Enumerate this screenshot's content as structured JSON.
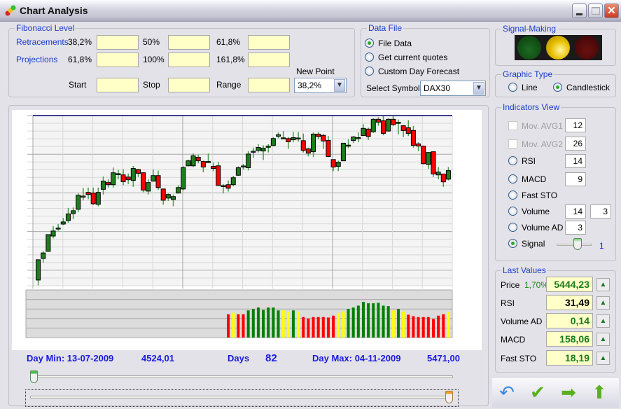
{
  "window": {
    "title": "Chart Analysis",
    "minimize": "_",
    "maximize": "□",
    "close": "✕"
  },
  "fibonacci": {
    "title": "Fibonacci Level",
    "retracements_label": "Retracements",
    "projections_label": "Projections",
    "retracements": [
      {
        "label": "38,2%",
        "value": ""
      },
      {
        "label": "50%",
        "value": ""
      },
      {
        "label": "61,8%",
        "value": ""
      }
    ],
    "projections": [
      {
        "label": "61,8%",
        "value": ""
      },
      {
        "label": "100%",
        "value": ""
      },
      {
        "label": "161,8%",
        "value": ""
      }
    ],
    "start_label": "Start",
    "stop_label": "Stop",
    "range_label": "Range",
    "start": "",
    "stop": "",
    "range": "",
    "new_point_label": "New Point",
    "new_point": "38,2%"
  },
  "data_file": {
    "title": "Data File",
    "options": [
      "File Data",
      "Get current quotes",
      "Custom Day Forecast"
    ],
    "selected": 0,
    "symbol_label": "Select Symbol",
    "symbol": "DAX30"
  },
  "signal_making": {
    "title": "Signal-Making",
    "lights": {
      "green": "#0c4a10",
      "yellow": "#f0cc10",
      "red": "#4a0808"
    },
    "active": "yellow"
  },
  "graphic_type": {
    "title": "Graphic Type",
    "options": [
      "Line",
      "Candlestick"
    ],
    "selected": 1
  },
  "indicators": {
    "title": "Indicators View",
    "mov_avg1": {
      "label": "Mov. AVG1",
      "value": "12",
      "enabled": false
    },
    "mov_avg2": {
      "label": "Mov. AVG2",
      "value": "26",
      "enabled": false
    },
    "rsi": {
      "label": "RSI",
      "value": "14"
    },
    "macd": {
      "label": "MACD",
      "value": "9"
    },
    "fast_sto": {
      "label": "Fast STO"
    },
    "volume": {
      "label": "Volume",
      "value1": "14",
      "value2": "3"
    },
    "volume_ad": {
      "label": "Volume AD",
      "value": "3"
    },
    "signal": {
      "label": "Signal",
      "slider_value": "1"
    },
    "selected": "Signal"
  },
  "last_values": {
    "title": "Last Values",
    "price_label": "Price",
    "price_change": "1,70%",
    "price": "5444,23",
    "rsi_label": "RSI",
    "rsi": "31,49",
    "volume_ad_label": "Volume AD",
    "volume_ad": "0,14",
    "macd_label": "MACD",
    "macd": "158,06",
    "fast_sto_label": "Fast STO",
    "fast_sto": "18,19",
    "trend_icon": "▲"
  },
  "stats": {
    "day_min": "Day Min: 13-07-2009",
    "min_value": "4524,01",
    "days_label": "Days",
    "days": "82",
    "day_max": "Day Max: 04-11-2009",
    "max_value": "5471,00"
  },
  "toolbar": {
    "undo_icon": "↶",
    "ok_icon": "✔",
    "next_icon": "➡",
    "up_icon": "⬆"
  },
  "chart_data": {
    "type": "candlestick",
    "ylim": [
      4524.01,
      5471.0
    ],
    "grid": true,
    "colors": {
      "up": "#1e7e1e",
      "down": "#ff0000"
    },
    "candles": [
      [
        4552,
        4666,
        4523,
        4666
      ],
      [
        4673,
        4716,
        4650,
        4704
      ],
      [
        4713,
        4807,
        4713,
        4807
      ],
      [
        4799,
        4854,
        4786,
        4827
      ],
      [
        4844,
        4867,
        4828,
        4844
      ],
      [
        4866,
        4900,
        4861,
        4878
      ],
      [
        4886,
        4957,
        4874,
        4923
      ],
      [
        4925,
        4959,
        4894,
        4941
      ],
      [
        4949,
        5038,
        4933,
        5028
      ],
      [
        5023,
        5069,
        4999,
        5023
      ],
      [
        5044,
        5071,
        5005,
        5032
      ],
      [
        5040,
        5071,
        4973,
        4980
      ],
      [
        4977,
        5071,
        4966,
        5044
      ],
      [
        5061,
        5133,
        5032,
        5107
      ],
      [
        5099,
        5117,
        5071,
        5087
      ],
      [
        5087,
        5183,
        5071,
        5154
      ],
      [
        5149,
        5170,
        5117,
        5149
      ],
      [
        5142,
        5174,
        5084,
        5104
      ],
      [
        5130,
        5150,
        5091,
        5115
      ],
      [
        5111,
        5192,
        5075,
        5178
      ],
      [
        5172,
        5176,
        5130,
        5151
      ],
      [
        5154,
        5157,
        5045,
        5057
      ],
      [
        5051,
        5117,
        5032,
        5099
      ],
      [
        5107,
        5172,
        5104,
        5138
      ],
      [
        5138,
        5166,
        5058,
        5071
      ],
      [
        5063,
        5063,
        4975,
        5000
      ],
      [
        5012,
        5038,
        4996,
        5032
      ],
      [
        5004,
        5032,
        4966,
        5020
      ],
      [
        5040,
        5084,
        5038,
        5071
      ],
      [
        5063,
        5190,
        5054,
        5183
      ],
      [
        5193,
        5228,
        5190,
        5221
      ],
      [
        5193,
        5262,
        5186,
        5249
      ],
      [
        5241,
        5255,
        5207,
        5221
      ],
      [
        5217,
        5222,
        5157,
        5186
      ],
      [
        5217,
        5262,
        5209,
        5217
      ],
      [
        5190,
        5212,
        5162,
        5178
      ],
      [
        5193,
        5216,
        5080,
        5083
      ],
      [
        5082,
        5091,
        5038,
        5082
      ],
      [
        5087,
        5111,
        5049,
        5067
      ],
      [
        5087,
        5137,
        5078,
        5126
      ],
      [
        5140,
        5190,
        5137,
        5182
      ],
      [
        5192,
        5203,
        5172,
        5192
      ],
      [
        5182,
        5275,
        5167,
        5259
      ],
      [
        5275,
        5295,
        5238,
        5275
      ],
      [
        5279,
        5314,
        5268,
        5296
      ],
      [
        5276,
        5308,
        5226,
        5292
      ],
      [
        5303,
        5314,
        5268,
        5303
      ],
      [
        5307,
        5354,
        5304,
        5346
      ],
      [
        5359,
        5380,
        5347,
        5367
      ],
      [
        5350,
        5387,
        5343,
        5350
      ],
      [
        5346,
        5354,
        5288,
        5328
      ],
      [
        5339,
        5383,
        5325,
        5351
      ],
      [
        5349,
        5383,
        5328,
        5349
      ],
      [
        5334,
        5374,
        5268,
        5280
      ],
      [
        5288,
        5295,
        5246,
        5264
      ],
      [
        5272,
        5380,
        5242,
        5371
      ],
      [
        5371,
        5383,
        5341,
        5357
      ],
      [
        5364,
        5370,
        5288,
        5332
      ],
      [
        5335,
        5360,
        5242,
        5245
      ],
      [
        5228,
        5228,
        5163,
        5186
      ],
      [
        5190,
        5222,
        5163,
        5213
      ],
      [
        5221,
        5320,
        5221,
        5320
      ],
      [
        5309,
        5341,
        5291,
        5309
      ],
      [
        5335,
        5360,
        5321,
        5355
      ],
      [
        5351,
        5380,
        5325,
        5351
      ],
      [
        5363,
        5426,
        5360,
        5403
      ],
      [
        5399,
        5407,
        5338,
        5357
      ],
      [
        5384,
        5459,
        5378,
        5454
      ],
      [
        5454,
        5466,
        5417,
        5438
      ],
      [
        5446,
        5471,
        5364,
        5375
      ],
      [
        5388,
        5459,
        5385,
        5454
      ],
      [
        5454,
        5471,
        5417,
        5424
      ],
      [
        5437,
        5453,
        5370,
        5437
      ],
      [
        5418,
        5422,
        5354,
        5391
      ],
      [
        5407,
        5449,
        5360,
        5375
      ],
      [
        5391,
        5417,
        5295,
        5308
      ],
      [
        5316,
        5325,
        5275,
        5304
      ],
      [
        5303,
        5307,
        5201,
        5205
      ],
      [
        5201,
        5268,
        5176,
        5268
      ],
      [
        5272,
        5272,
        5130,
        5147
      ],
      [
        5142,
        5186,
        5117,
        5158
      ],
      [
        5147,
        5147,
        5075,
        5103
      ],
      [
        5118,
        5186,
        5111,
        5166
      ]
    ],
    "signal_bars": {
      "colors": {
        "R": "#ff0000",
        "Y": "#ffff00",
        "G": "#008000"
      },
      "levels_pct": [
        49,
        52,
        49,
        49,
        57,
        60,
        63,
        58,
        63,
        63,
        57,
        57,
        54,
        57,
        54,
        43,
        40,
        43,
        43,
        43,
        42,
        46,
        52,
        55,
        60,
        63,
        67,
        75,
        72,
        72,
        73,
        67,
        66,
        57,
        60,
        55,
        48,
        45,
        43,
        43,
        43,
        39,
        46,
        49,
        54
      ],
      "signals": [
        "R",
        "Y",
        "R",
        "R",
        "G",
        "G",
        "G",
        "G",
        "G",
        "G",
        "G",
        "Y",
        "Y",
        "G",
        "Y",
        "R",
        "R",
        "R",
        "R",
        "R",
        "R",
        "R",
        "Y",
        "Y",
        "G",
        "G",
        "G",
        "G",
        "G",
        "G",
        "G",
        "G",
        "G",
        "Y",
        "G",
        "Y",
        "R",
        "R",
        "R",
        "R",
        "R",
        "R",
        "R",
        "R",
        "Y"
      ]
    }
  }
}
